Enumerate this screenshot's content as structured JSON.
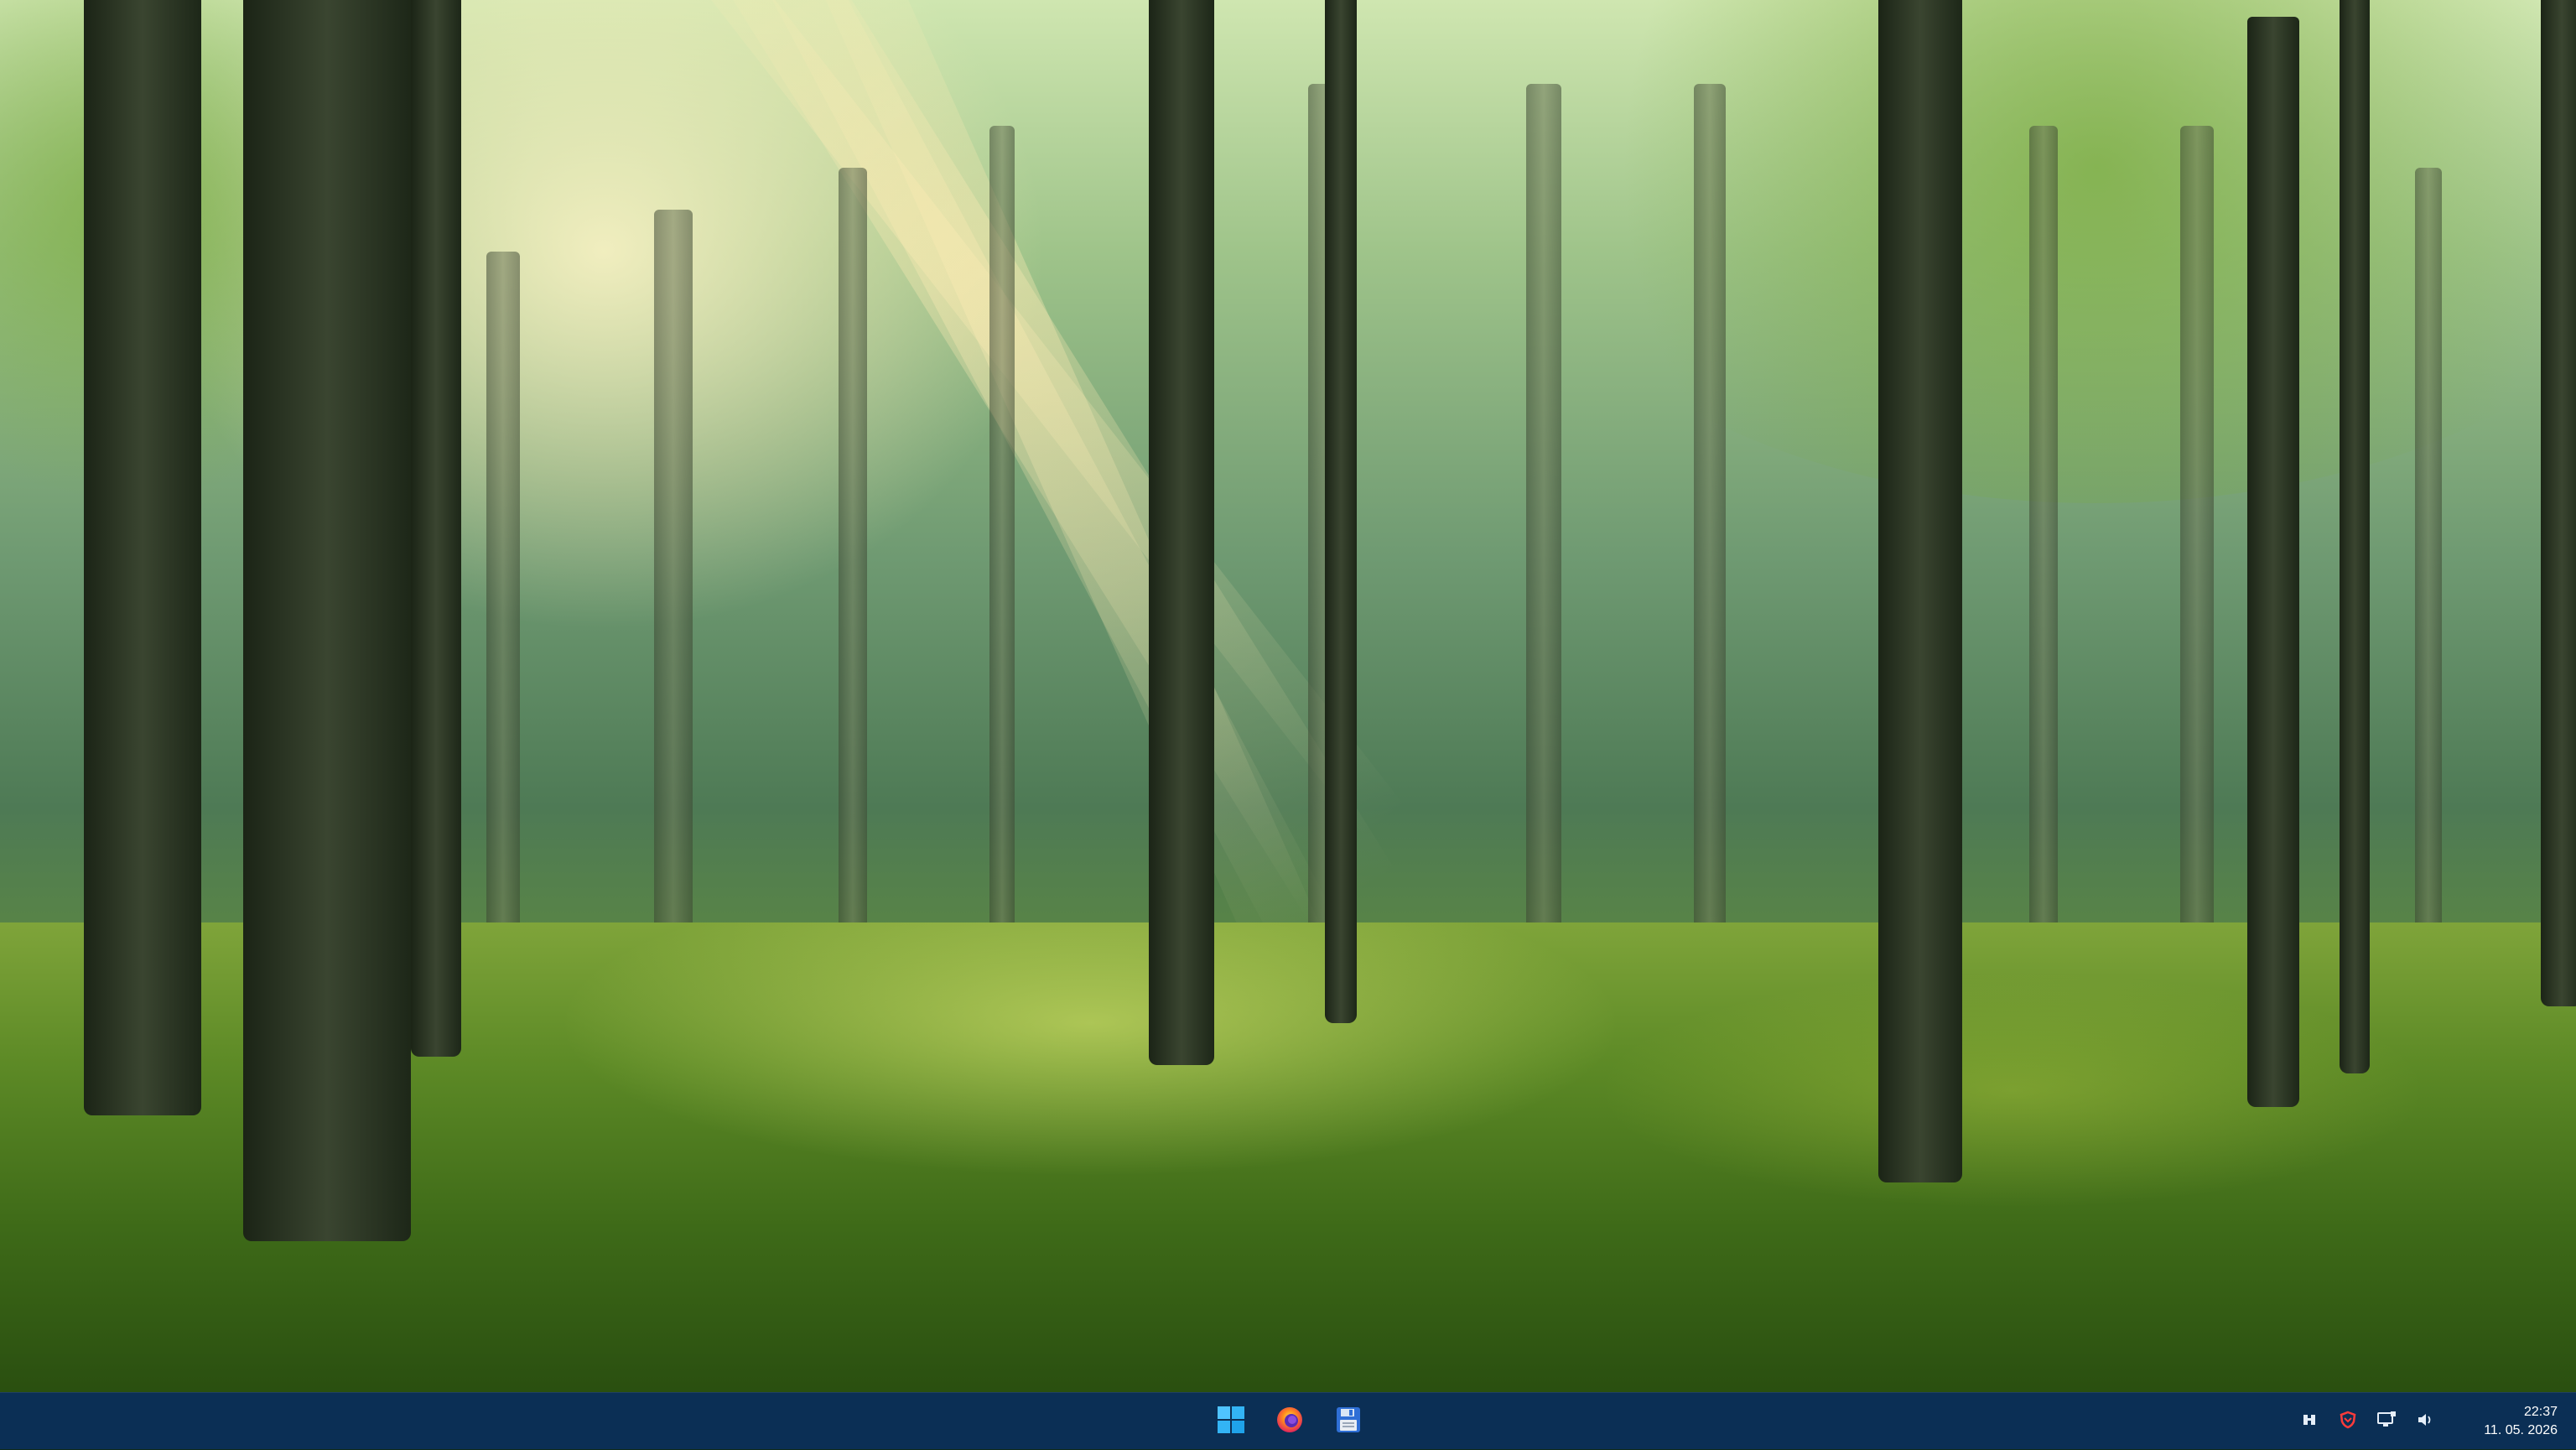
{
  "desktop": {
    "wallpaper": "sunlit forest with light rays"
  },
  "taskbar": {
    "background": "#0b2f55",
    "pinned": [
      {
        "name": "start-button",
        "icon": "windows-logo-icon"
      },
      {
        "name": "firefox-button",
        "icon": "firefox-icon"
      },
      {
        "name": "app-button",
        "icon": "floppy-disk-icon"
      }
    ],
    "tray": {
      "icons": [
        "tray-app-icon",
        "antivirus-shield-icon",
        "network-icon",
        "volume-icon"
      ],
      "time": "22:37",
      "date": "11. 05. 2026"
    }
  }
}
